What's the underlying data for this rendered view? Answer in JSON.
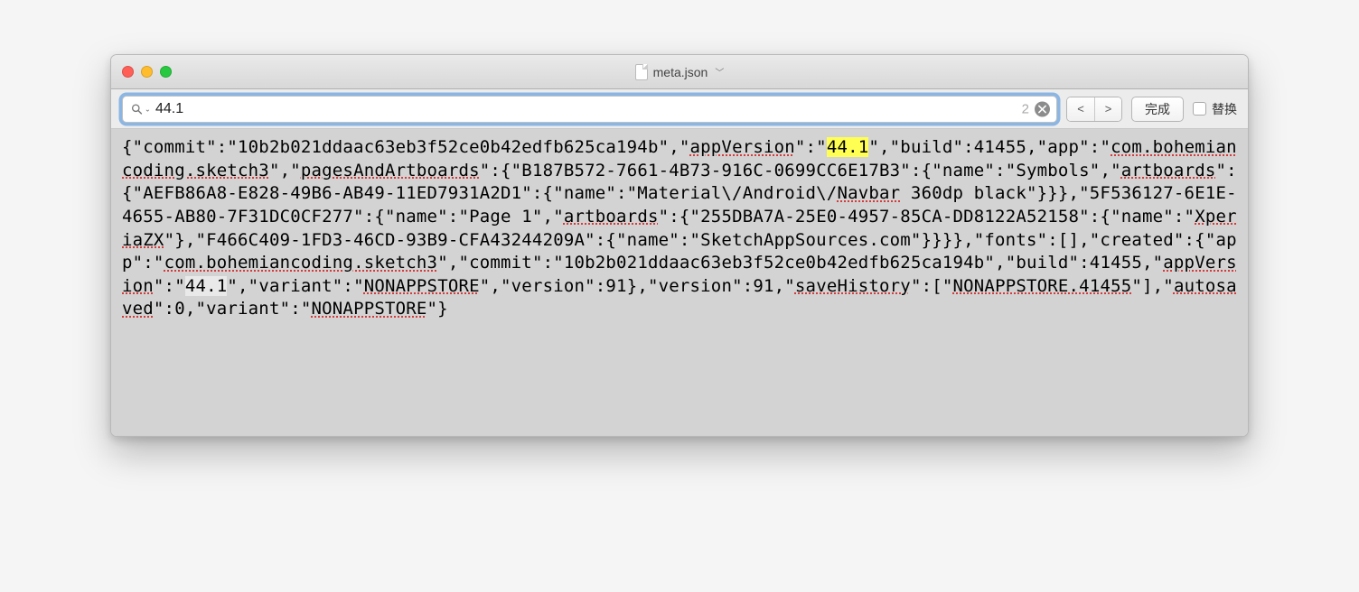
{
  "titlebar": {
    "filename": "meta.json"
  },
  "findbar": {
    "search_value": "44.1",
    "result_count": "2",
    "done_label": "完成",
    "replace_label": "替换",
    "prev": "<",
    "next": ">"
  },
  "colors": {
    "highlight_primary": "#ffff53",
    "highlight_secondary": "#e9e9e9"
  },
  "content": {
    "segments": [
      {
        "t": "{\"commit\":\"10b2b021ddaac63eb3f52ce0b42edfb625ca194b\",\""
      },
      {
        "t": "appVersion",
        "squig": true
      },
      {
        "t": "\":\""
      },
      {
        "t": "44.1",
        "hl": "y"
      },
      {
        "t": "\",\"build\":41455,\"app\":\""
      },
      {
        "t": "com.bohemiancoding.sketch3",
        "squig": true
      },
      {
        "t": "\",\""
      },
      {
        "t": "pagesAndArtboards",
        "squig": true
      },
      {
        "t": "\":{\"B187B572-7661-4B73-916C-0699CC6E17B3\":{\"name\":\"Symbols\",\""
      },
      {
        "t": "artboards",
        "squig": true
      },
      {
        "t": "\":{\"AEFB86A8-E828-49B6-AB49-11ED7931A2D1\":{\"name\":\"Material\\/Android\\/"
      },
      {
        "t": "Navbar",
        "squig": true
      },
      {
        "t": " 360dp black\"}}},\"5F536127-6E1E-4655-AB80-7F31DC0CF277\":{\"name\":\"Page 1\",\""
      },
      {
        "t": "artboards",
        "squig": true
      },
      {
        "t": "\":{\"255DBA7A-25E0-4957-85CA-DD8122A52158\":{\"name\":\""
      },
      {
        "t": "XperiaZX",
        "squig": true
      },
      {
        "t": "\"},\"F466C409-1FD3-46CD-93B9-CFA43244209A\":{\"name\":\"SketchAppSources.com\"}}}},\"fonts\":[],\"created\":{\"app\":\""
      },
      {
        "t": "com.bohemiancoding.sketch3",
        "squig": true
      },
      {
        "t": "\",\"commit\":\"10b2b021ddaac63eb3f52ce0b42edfb625ca194b\",\"build\":41455,\""
      },
      {
        "t": "appVersion",
        "squig": true
      },
      {
        "t": "\":\""
      },
      {
        "t": "44.1",
        "hl": "w"
      },
      {
        "t": "\",\"variant\":\""
      },
      {
        "t": "NONAPPSTORE",
        "squig": true
      },
      {
        "t": "\",\"version\":91},\"version\":91,\""
      },
      {
        "t": "saveHistory",
        "squig": true
      },
      {
        "t": "\":[\""
      },
      {
        "t": "NONAPPSTORE.41455",
        "squig": true
      },
      {
        "t": "\"],\""
      },
      {
        "t": "autosaved",
        "squig": true
      },
      {
        "t": "\":0,\"variant\":\""
      },
      {
        "t": "NONAPPSTORE",
        "squig": true
      },
      {
        "t": "\"}"
      }
    ]
  }
}
